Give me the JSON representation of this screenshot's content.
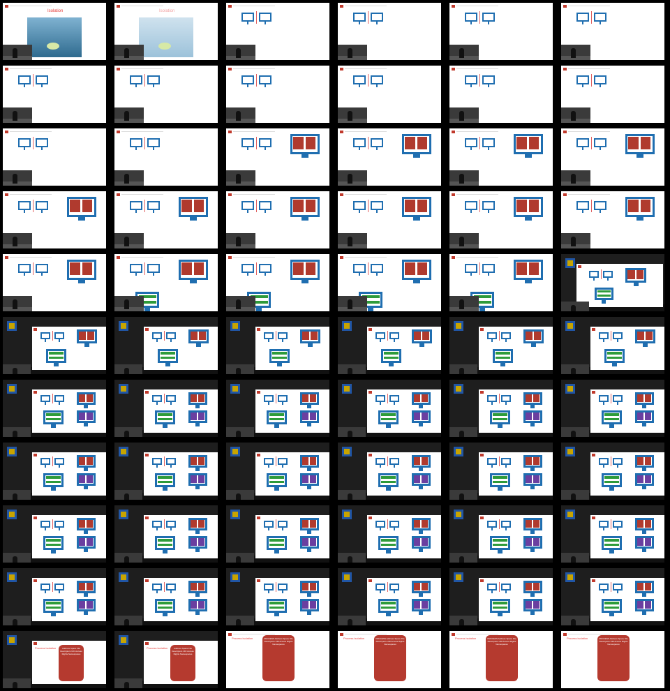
{
  "slide_titles": {
    "isolation": "Isolation",
    "process_isolation": "Process isolation"
  },
  "process_block_lines": [
    "Address Space",
    "File Descriptors",
    "UID",
    "Access Rights",
    "Namespaces"
  ],
  "process_block_title": "PROCESS",
  "icons": [
    "monitor-icon",
    "processor-icon",
    "camera-feed",
    "university-logo"
  ],
  "colors": {
    "accent_red": "#c0392b",
    "monitor_blue": "#1f6eb0",
    "process_red": "#b03a2e",
    "green": "#2e9b3a",
    "purple": "#6a3fa0"
  }
}
